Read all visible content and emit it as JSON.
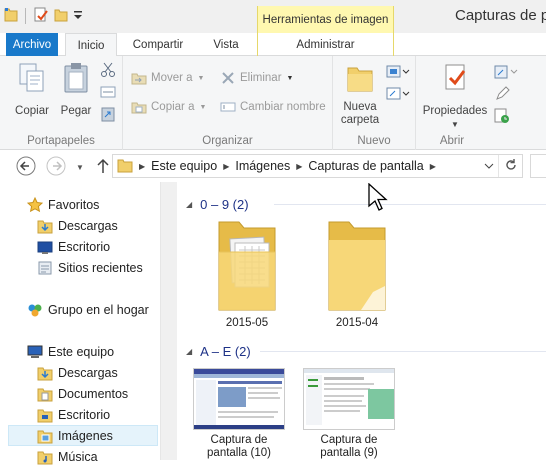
{
  "titlebar": {
    "window_title": "Capturas de p",
    "context_tool": "Herramientas de imagen"
  },
  "tabs": {
    "archivo": "Archivo",
    "inicio": "Inicio",
    "compartir": "Compartir",
    "vista": "Vista",
    "administrar": "Administrar"
  },
  "ribbon": {
    "portapapeles": {
      "label": "Portapapeles",
      "copiar": "Copiar",
      "pegar": "Pegar"
    },
    "organizar": {
      "label": "Organizar",
      "mover_a": "Mover a",
      "copiar_a": "Copiar a",
      "eliminar": "Eliminar",
      "cambiar_nombre": "Cambiar nombre"
    },
    "nuevo": {
      "label": "Nuevo",
      "nueva_carpeta_1": "Nueva",
      "nueva_carpeta_2": "carpeta"
    },
    "abrir": {
      "label": "Abrir",
      "propiedades": "Propiedades"
    }
  },
  "address": {
    "crumbs": [
      "Este equipo",
      "Imágenes",
      "Capturas de pantalla"
    ]
  },
  "navpane": {
    "items": [
      {
        "label": "Favoritos"
      },
      {
        "label": "Descargas"
      },
      {
        "label": "Escritorio"
      },
      {
        "label": "Sitios recientes"
      },
      {
        "label": "Grupo en el hogar"
      },
      {
        "label": "Este equipo"
      },
      {
        "label": "Descargas"
      },
      {
        "label": "Documentos"
      },
      {
        "label": "Escritorio"
      },
      {
        "label": "Imágenes"
      },
      {
        "label": "Música"
      }
    ]
  },
  "content": {
    "groups": [
      {
        "header": "0 – 9 (2)",
        "items": [
          {
            "label": "2015-05"
          },
          {
            "label": "2015-04"
          }
        ]
      },
      {
        "header": "A – E (2)",
        "items": [
          {
            "label_1": "Captura de",
            "label_2": "pantalla (10)"
          },
          {
            "label_1": "Captura de",
            "label_2": "pantalla (9)"
          }
        ]
      }
    ]
  },
  "colors": {
    "accent": "#1979ca",
    "context_tab": "#fff8b0",
    "selection": "#e5f3fb",
    "group_header": "#1e3287",
    "folder": "#f1cf6b"
  }
}
